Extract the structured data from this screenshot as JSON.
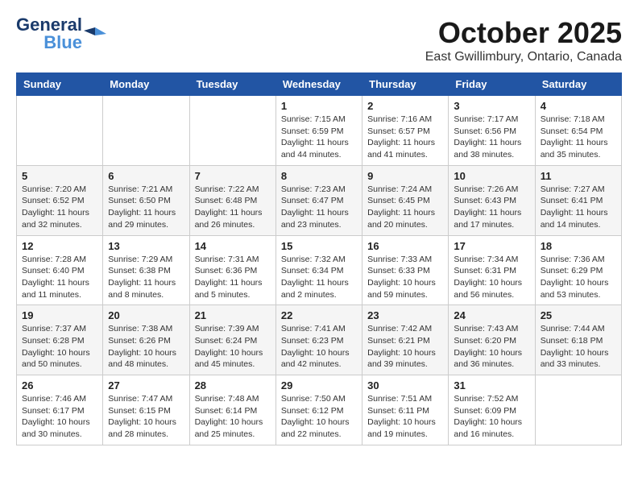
{
  "header": {
    "logo_line1": "General",
    "logo_line2": "Blue",
    "title": "October 2025",
    "subtitle": "East Gwillimbury, Ontario, Canada"
  },
  "weekdays": [
    "Sunday",
    "Monday",
    "Tuesday",
    "Wednesday",
    "Thursday",
    "Friday",
    "Saturday"
  ],
  "weeks": [
    [
      {
        "day": "",
        "info": ""
      },
      {
        "day": "",
        "info": ""
      },
      {
        "day": "",
        "info": ""
      },
      {
        "day": "1",
        "info": "Sunrise: 7:15 AM\nSunset: 6:59 PM\nDaylight: 11 hours and 44 minutes."
      },
      {
        "day": "2",
        "info": "Sunrise: 7:16 AM\nSunset: 6:57 PM\nDaylight: 11 hours and 41 minutes."
      },
      {
        "day": "3",
        "info": "Sunrise: 7:17 AM\nSunset: 6:56 PM\nDaylight: 11 hours and 38 minutes."
      },
      {
        "day": "4",
        "info": "Sunrise: 7:18 AM\nSunset: 6:54 PM\nDaylight: 11 hours and 35 minutes."
      }
    ],
    [
      {
        "day": "5",
        "info": "Sunrise: 7:20 AM\nSunset: 6:52 PM\nDaylight: 11 hours and 32 minutes."
      },
      {
        "day": "6",
        "info": "Sunrise: 7:21 AM\nSunset: 6:50 PM\nDaylight: 11 hours and 29 minutes."
      },
      {
        "day": "7",
        "info": "Sunrise: 7:22 AM\nSunset: 6:48 PM\nDaylight: 11 hours and 26 minutes."
      },
      {
        "day": "8",
        "info": "Sunrise: 7:23 AM\nSunset: 6:47 PM\nDaylight: 11 hours and 23 minutes."
      },
      {
        "day": "9",
        "info": "Sunrise: 7:24 AM\nSunset: 6:45 PM\nDaylight: 11 hours and 20 minutes."
      },
      {
        "day": "10",
        "info": "Sunrise: 7:26 AM\nSunset: 6:43 PM\nDaylight: 11 hours and 17 minutes."
      },
      {
        "day": "11",
        "info": "Sunrise: 7:27 AM\nSunset: 6:41 PM\nDaylight: 11 hours and 14 minutes."
      }
    ],
    [
      {
        "day": "12",
        "info": "Sunrise: 7:28 AM\nSunset: 6:40 PM\nDaylight: 11 hours and 11 minutes."
      },
      {
        "day": "13",
        "info": "Sunrise: 7:29 AM\nSunset: 6:38 PM\nDaylight: 11 hours and 8 minutes."
      },
      {
        "day": "14",
        "info": "Sunrise: 7:31 AM\nSunset: 6:36 PM\nDaylight: 11 hours and 5 minutes."
      },
      {
        "day": "15",
        "info": "Sunrise: 7:32 AM\nSunset: 6:34 PM\nDaylight: 11 hours and 2 minutes."
      },
      {
        "day": "16",
        "info": "Sunrise: 7:33 AM\nSunset: 6:33 PM\nDaylight: 10 hours and 59 minutes."
      },
      {
        "day": "17",
        "info": "Sunrise: 7:34 AM\nSunset: 6:31 PM\nDaylight: 10 hours and 56 minutes."
      },
      {
        "day": "18",
        "info": "Sunrise: 7:36 AM\nSunset: 6:29 PM\nDaylight: 10 hours and 53 minutes."
      }
    ],
    [
      {
        "day": "19",
        "info": "Sunrise: 7:37 AM\nSunset: 6:28 PM\nDaylight: 10 hours and 50 minutes."
      },
      {
        "day": "20",
        "info": "Sunrise: 7:38 AM\nSunset: 6:26 PM\nDaylight: 10 hours and 48 minutes."
      },
      {
        "day": "21",
        "info": "Sunrise: 7:39 AM\nSunset: 6:24 PM\nDaylight: 10 hours and 45 minutes."
      },
      {
        "day": "22",
        "info": "Sunrise: 7:41 AM\nSunset: 6:23 PM\nDaylight: 10 hours and 42 minutes."
      },
      {
        "day": "23",
        "info": "Sunrise: 7:42 AM\nSunset: 6:21 PM\nDaylight: 10 hours and 39 minutes."
      },
      {
        "day": "24",
        "info": "Sunrise: 7:43 AM\nSunset: 6:20 PM\nDaylight: 10 hours and 36 minutes."
      },
      {
        "day": "25",
        "info": "Sunrise: 7:44 AM\nSunset: 6:18 PM\nDaylight: 10 hours and 33 minutes."
      }
    ],
    [
      {
        "day": "26",
        "info": "Sunrise: 7:46 AM\nSunset: 6:17 PM\nDaylight: 10 hours and 30 minutes."
      },
      {
        "day": "27",
        "info": "Sunrise: 7:47 AM\nSunset: 6:15 PM\nDaylight: 10 hours and 28 minutes."
      },
      {
        "day": "28",
        "info": "Sunrise: 7:48 AM\nSunset: 6:14 PM\nDaylight: 10 hours and 25 minutes."
      },
      {
        "day": "29",
        "info": "Sunrise: 7:50 AM\nSunset: 6:12 PM\nDaylight: 10 hours and 22 minutes."
      },
      {
        "day": "30",
        "info": "Sunrise: 7:51 AM\nSunset: 6:11 PM\nDaylight: 10 hours and 19 minutes."
      },
      {
        "day": "31",
        "info": "Sunrise: 7:52 AM\nSunset: 6:09 PM\nDaylight: 10 hours and 16 minutes."
      },
      {
        "day": "",
        "info": ""
      }
    ]
  ]
}
